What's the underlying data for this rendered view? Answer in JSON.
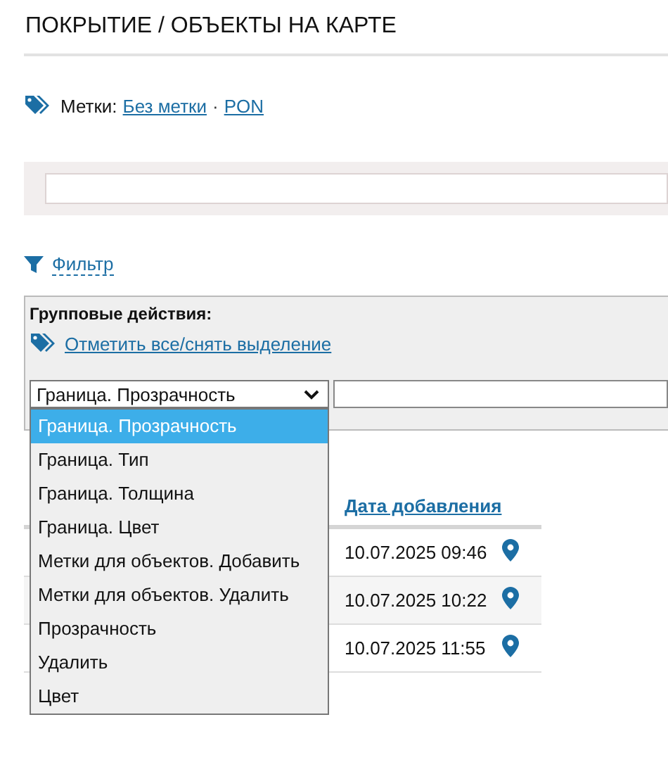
{
  "page_title": "ПОКРЫТИЕ / ОБЪЕКТЫ НА КАРТЕ",
  "tags": {
    "label": "Метки:",
    "links": [
      "Без метки",
      "PON"
    ],
    "separator": "·"
  },
  "filter_link": "Фильтр",
  "group_actions": {
    "title": "Групповые действия:",
    "toggle_link": "Отметить все/снять выделение",
    "action_select": {
      "value": "Граница. Прозрачность",
      "expanded": true,
      "options": [
        {
          "label": "Граница. Прозрачность",
          "selected": true
        },
        {
          "label": "Граница. Тип",
          "selected": false
        },
        {
          "label": "Граница. Толщина",
          "selected": false
        },
        {
          "label": "Граница. Цвет",
          "selected": false
        },
        {
          "label": "Метки для объектов. Добавить",
          "selected": false
        },
        {
          "label": "Метки для объектов. Удалить",
          "selected": false
        },
        {
          "label": "Прозрачность",
          "selected": false
        },
        {
          "label": "Удалить",
          "selected": false
        },
        {
          "label": "Цвет",
          "selected": false
        }
      ]
    }
  },
  "table": {
    "columns": [
      "Дата добавления"
    ],
    "rows": [
      {
        "date_added": "10.07.2025 09:46"
      },
      {
        "date_added": "10.07.2025 10:22"
      },
      {
        "date_added": "10.07.2025 11:55"
      }
    ]
  }
}
